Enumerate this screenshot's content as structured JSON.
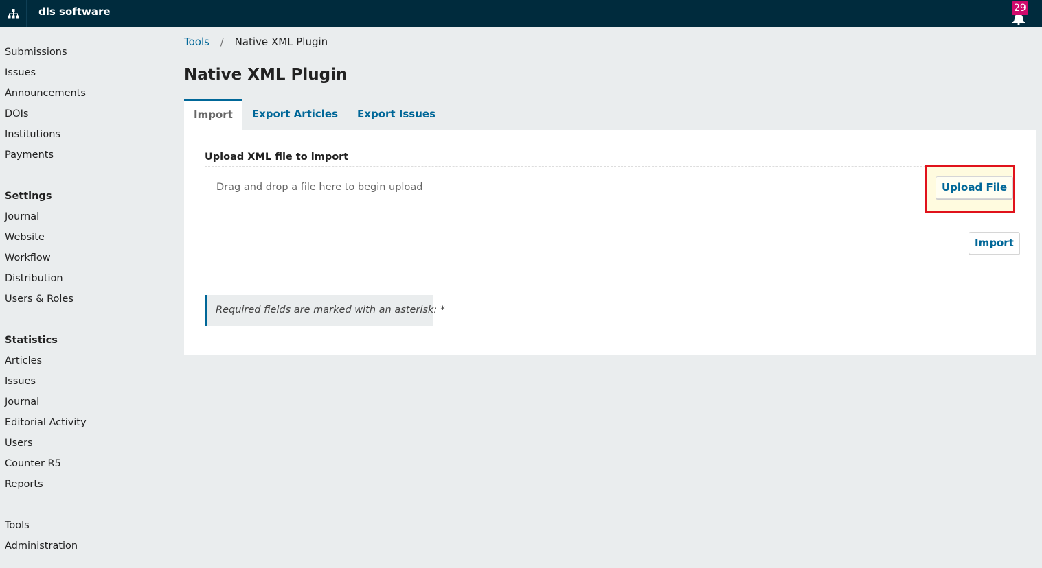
{
  "header": {
    "app_name": "dls software",
    "notifications_count": "29",
    "apps_icon": "sitemap-icon",
    "notifications_icon": "bell-icon"
  },
  "sidebar": {
    "main": [
      "Submissions",
      "Issues",
      "Announcements",
      "DOIs",
      "Institutions",
      "Payments"
    ],
    "settings_heading": "Settings",
    "settings": [
      "Journal",
      "Website",
      "Workflow",
      "Distribution",
      "Users & Roles"
    ],
    "statistics_heading": "Statistics",
    "statistics": [
      "Articles",
      "Issues",
      "Journal",
      "Editorial Activity",
      "Users",
      "Counter R5",
      "Reports"
    ],
    "other": [
      "Tools",
      "Administration"
    ]
  },
  "breadcrumb": {
    "parent": "Tools",
    "separator": "/",
    "current": "Native XML Plugin"
  },
  "page": {
    "title": "Native XML Plugin"
  },
  "tabs": [
    {
      "label": "Import",
      "active": true
    },
    {
      "label": "Export Articles",
      "active": false
    },
    {
      "label": "Export Issues",
      "active": false
    }
  ],
  "import_form": {
    "upload_label": "Upload XML file to import",
    "dropzone_text": "Drag and drop a file here to begin upload",
    "upload_button": "Upload File",
    "import_button": "Import",
    "required_note": "Required fields are marked with an asterisk:",
    "asterisk": "*"
  },
  "colors": {
    "header_bg": "#002b3d",
    "accent": "#006798",
    "badge": "#d00a6c",
    "highlight": "#e0121b"
  }
}
